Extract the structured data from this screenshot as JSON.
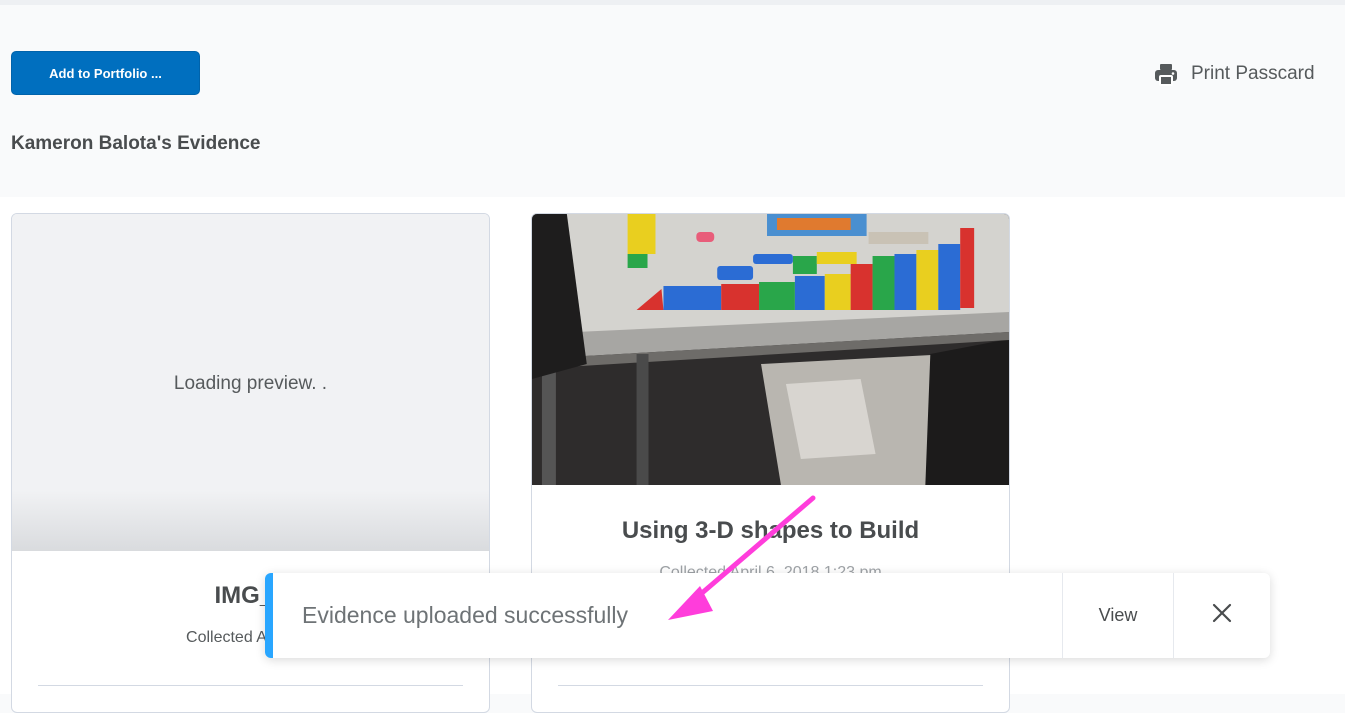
{
  "toolbar": {
    "add_button_label": "Add to Portfolio ...",
    "print_label": "Print Passcard"
  },
  "page": {
    "title": "Kameron Balota's Evidence"
  },
  "cards": [
    {
      "preview_text": "Loading preview. .",
      "title": "IMG_7",
      "meta": "Collected April 27,"
    },
    {
      "title": "Using 3-D shapes to Build",
      "meta": "Collected April 6, 2018 1:23 pm"
    }
  ],
  "toast": {
    "message": "Evidence uploaded successfully",
    "view_label": "View",
    "close_icon": "close-icon"
  },
  "colors": {
    "primary": "#006fbf",
    "toast_accent": "#29a6ff",
    "annotation_arrow": "#ff3ddb"
  }
}
